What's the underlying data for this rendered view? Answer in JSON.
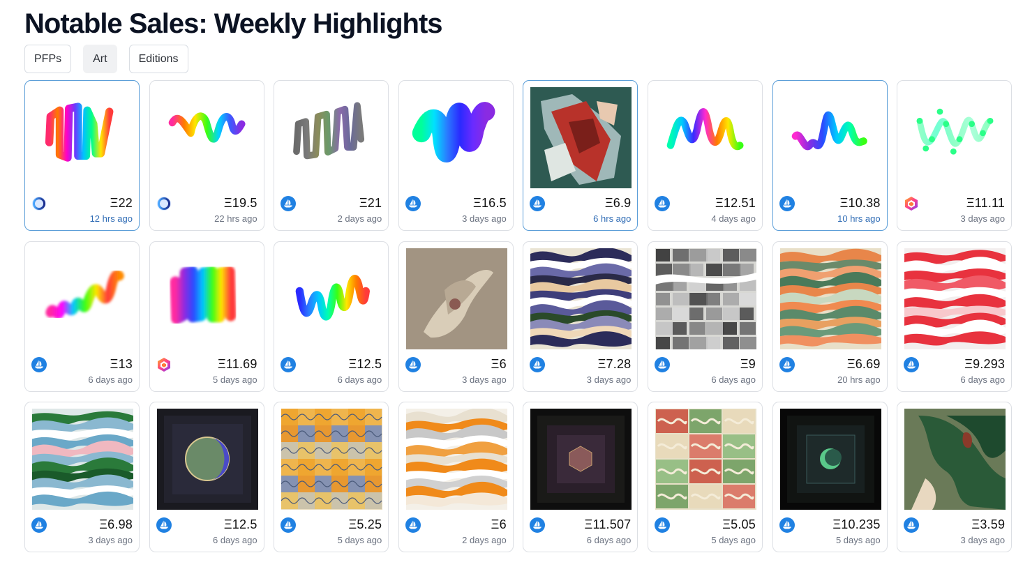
{
  "page": {
    "title": "Notable Sales: Weekly Highlights"
  },
  "tabs": [
    {
      "label": "PFPs",
      "active": false
    },
    {
      "label": "Art",
      "active": true
    },
    {
      "label": "Editions",
      "active": false
    }
  ],
  "currency_symbol": "Ξ",
  "marketplace_icons": {
    "os": "opensea-ship-icon",
    "ring": "ring-marketplace-icon",
    "lr": "looksrare-hexagon-icon"
  },
  "sales": [
    {
      "price": "Ξ22",
      "time": "12 hrs ago",
      "marketplace": "ring",
      "art": "squiggle",
      "highlight": true
    },
    {
      "price": "Ξ19.5",
      "time": "22 hrs ago",
      "marketplace": "ring",
      "art": "squiggle",
      "highlight": false
    },
    {
      "price": "Ξ21",
      "time": "2 days ago",
      "marketplace": "os",
      "art": "squiggle",
      "highlight": false
    },
    {
      "price": "Ξ16.5",
      "time": "3 days ago",
      "marketplace": "os",
      "art": "squiggle",
      "highlight": false
    },
    {
      "price": "Ξ6.9",
      "time": "6 hrs ago",
      "marketplace": "os",
      "art": "generative",
      "highlight": true
    },
    {
      "price": "Ξ12.51",
      "time": "4 days ago",
      "marketplace": "os",
      "art": "squiggle",
      "highlight": false
    },
    {
      "price": "Ξ10.38",
      "time": "10 hrs ago",
      "marketplace": "os",
      "art": "squiggle",
      "highlight": true
    },
    {
      "price": "Ξ11.11",
      "time": "3 days ago",
      "marketplace": "lr",
      "art": "squiggle",
      "highlight": false
    },
    {
      "price": "Ξ13",
      "time": "6 days ago",
      "marketplace": "os",
      "art": "squiggle",
      "highlight": false
    },
    {
      "price": "Ξ11.69",
      "time": "5 days ago",
      "marketplace": "lr",
      "art": "squiggle",
      "highlight": false
    },
    {
      "price": "Ξ12.5",
      "time": "6 days ago",
      "marketplace": "os",
      "art": "squiggle",
      "highlight": false
    },
    {
      "price": "Ξ6",
      "time": "3 days ago",
      "marketplace": "os",
      "art": "generative",
      "highlight": false
    },
    {
      "price": "Ξ7.28",
      "time": "3 days ago",
      "marketplace": "os",
      "art": "generative",
      "highlight": false
    },
    {
      "price": "Ξ9",
      "time": "6 days ago",
      "marketplace": "os",
      "art": "generative",
      "highlight": false
    },
    {
      "price": "Ξ6.69",
      "time": "20 hrs ago",
      "marketplace": "os",
      "art": "generative",
      "highlight": false
    },
    {
      "price": "Ξ9.293",
      "time": "6 days ago",
      "marketplace": "os",
      "art": "generative",
      "highlight": false
    },
    {
      "price": "Ξ6.98",
      "time": "3 days ago",
      "marketplace": "os",
      "art": "generative",
      "highlight": false
    },
    {
      "price": "Ξ12.5",
      "time": "6 days ago",
      "marketplace": "os",
      "art": "generative",
      "highlight": false
    },
    {
      "price": "Ξ5.25",
      "time": "5 days ago",
      "marketplace": "os",
      "art": "generative",
      "highlight": false
    },
    {
      "price": "Ξ6",
      "time": "2 days ago",
      "marketplace": "os",
      "art": "generative",
      "highlight": false
    },
    {
      "price": "Ξ11.507",
      "time": "6 days ago",
      "marketplace": "os",
      "art": "generative",
      "highlight": false
    },
    {
      "price": "Ξ5.05",
      "time": "5 days ago",
      "marketplace": "os",
      "art": "generative",
      "highlight": false
    },
    {
      "price": "Ξ10.235",
      "time": "5 days ago",
      "marketplace": "os",
      "art": "generative",
      "highlight": false
    },
    {
      "price": "Ξ3.59",
      "time": "3 days ago",
      "marketplace": "os",
      "art": "generative",
      "highlight": false
    }
  ],
  "colors": {
    "highlight_border": "#5b9ed8",
    "highlight_time": "#2f6cb5",
    "opensea_blue": "#2081e2"
  }
}
